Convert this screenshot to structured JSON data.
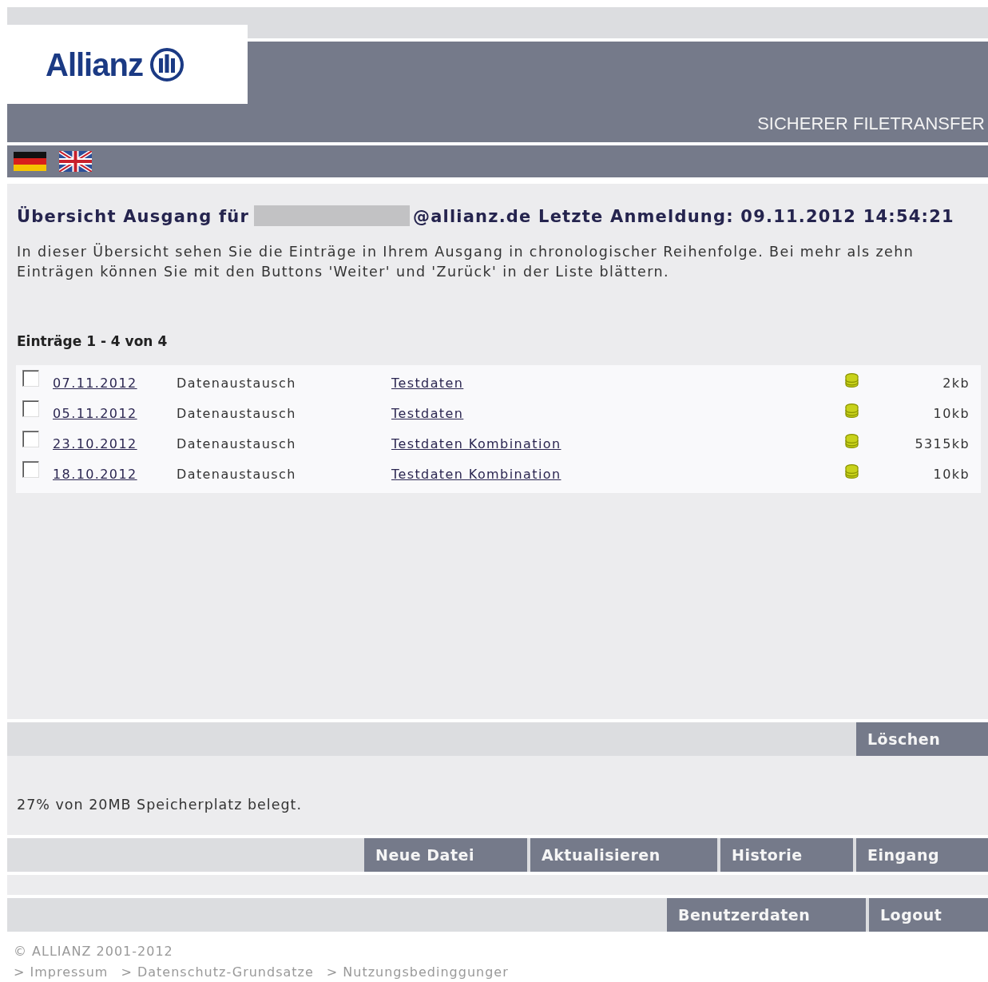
{
  "header": {
    "logo_text": "Allianz",
    "title": "SICHERER FILETRANSFER"
  },
  "languages": [
    {
      "kind": "german-flag"
    },
    {
      "kind": "british-flag"
    }
  ],
  "heading": {
    "before": "Übersicht Ausgang für",
    "redacted": true,
    "after": "@allianz.de Letzte Anmeldung: 09.11.2012 14:54:21"
  },
  "description": "In dieser Übersicht sehen Sie die Einträge in Ihrem Ausgang in chronologischer Reihenfolge. Bei mehr als zehn Einträgen können Sie mit den Buttons 'Weiter' und 'Zurück' in der Liste blättern.",
  "count_label": "Einträge 1 - 4 von 4",
  "entries": [
    {
      "checked": false,
      "date": "07.11.2012",
      "type": "Datenaustausch",
      "name": "Testdaten",
      "size": "2kb"
    },
    {
      "checked": false,
      "date": "05.11.2012",
      "type": "Datenaustausch",
      "name": "Testdaten",
      "size": "10kb"
    },
    {
      "checked": false,
      "date": "23.10.2012",
      "type": "Datenaustausch",
      "name": "Testdaten Kombination",
      "size": "5315kb"
    },
    {
      "checked": false,
      "date": "18.10.2012",
      "type": "Datenaustausch",
      "name": "Testdaten Kombination",
      "size": "10kb"
    }
  ],
  "delete_button": "Löschen",
  "storage_text": "27% von 20MB Speicherplatz belegt.",
  "nav_buttons": [
    "Neue Datei",
    "Aktualisieren",
    "Historie",
    "Eingang"
  ],
  "account_buttons": [
    "Benutzerdaten",
    "Logout"
  ],
  "footer": {
    "copyright": "© ALLIANZ 2001-2012",
    "links": [
      "> Impressum",
      "> Datenschutz-Grundsatze",
      "> Nutzungsbedinggunger"
    ]
  }
}
